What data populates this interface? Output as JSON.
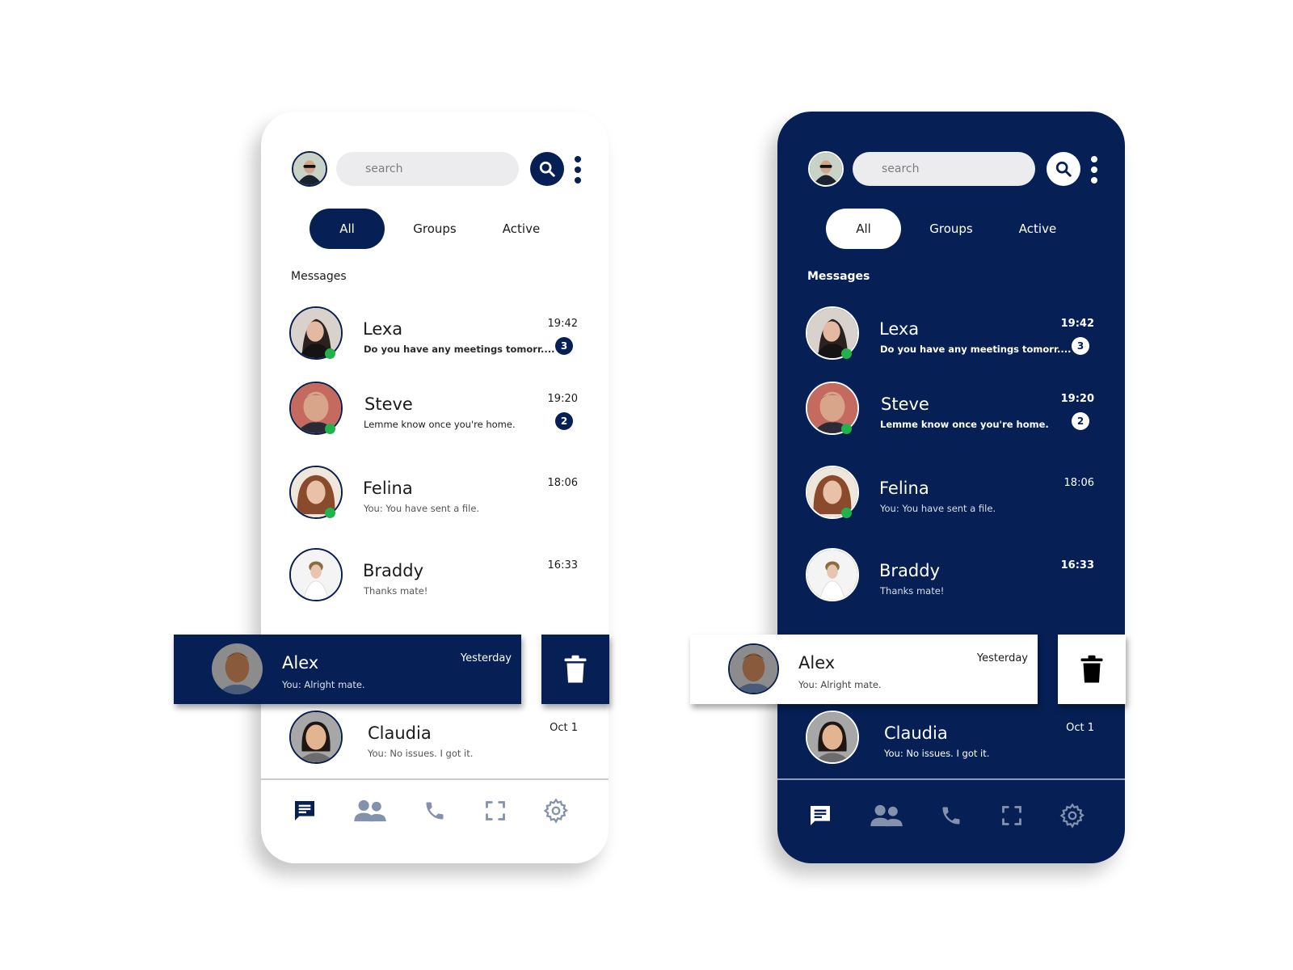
{
  "colors": {
    "brand_navy": "#062055",
    "online_green": "#22b24c",
    "search_bg": "#ececee",
    "nav_inactive": "#8391ad"
  },
  "themes": {
    "light": {
      "search": {
        "placeholder": "search"
      },
      "tabs": [
        {
          "label": "All",
          "selected": true
        },
        {
          "label": "Groups",
          "selected": false
        },
        {
          "label": "Active",
          "selected": false
        }
      ],
      "section_title": "Messages",
      "conversations": [
        {
          "name": "Lexa",
          "preview": "Do you have any meetings tomorr....",
          "time": "19:42",
          "unread": "3",
          "online": true
        },
        {
          "name": "Steve",
          "preview": "Lemme know once you're home.",
          "time": "19:20",
          "unread": "2",
          "online": true
        },
        {
          "name": "Felina",
          "preview": "You: You have sent a file.",
          "time": "18:06",
          "unread": null,
          "online": true
        },
        {
          "name": "Braddy",
          "preview": "Thanks mate!",
          "time": "16:33",
          "unread": null,
          "online": false
        },
        {
          "name": "Alex",
          "preview": "You: Alright mate.",
          "time": "Yesterday",
          "unread": null,
          "online": false,
          "swiped": true
        },
        {
          "name": "Claudia",
          "preview": "You: No issues. I got it.",
          "time": "Oct 1",
          "unread": null,
          "online": false
        }
      ],
      "nav": [
        {
          "icon": "chat-icon",
          "label": "Chats",
          "active": true
        },
        {
          "icon": "people-icon",
          "label": "Contacts",
          "active": false
        },
        {
          "icon": "phone-icon",
          "label": "Calls",
          "active": false
        },
        {
          "icon": "scan-icon",
          "label": "Scan",
          "active": false
        },
        {
          "icon": "gear-icon",
          "label": "Settings",
          "active": false
        }
      ]
    },
    "dark": {
      "search": {
        "placeholder": "search"
      },
      "tabs": [
        {
          "label": "All",
          "selected": true
        },
        {
          "label": "Groups",
          "selected": false
        },
        {
          "label": "Active",
          "selected": false
        }
      ],
      "section_title": "Messages",
      "conversations": [
        {
          "name": "Lexa",
          "preview": "Do you have any meetings tomorr....",
          "time": "19:42",
          "unread": "3",
          "online": true
        },
        {
          "name": "Steve",
          "preview": "Lemme know once you're home.",
          "time": "19:20",
          "unread": "2",
          "online": true
        },
        {
          "name": "Felina",
          "preview": "You: You have sent a file.",
          "time": "18:06",
          "unread": null,
          "online": true
        },
        {
          "name": "Braddy",
          "preview": "Thanks mate!",
          "time": "16:33",
          "unread": null,
          "online": false
        },
        {
          "name": "Alex",
          "preview": "You: Alright mate.",
          "time": "Yesterday",
          "unread": null,
          "online": false,
          "swiped": true
        },
        {
          "name": "Claudia",
          "preview": "You: No issues. I got it.",
          "time": "Oct 1",
          "unread": null,
          "online": false
        }
      ],
      "nav": [
        {
          "icon": "chat-icon",
          "label": "Chats",
          "active": true
        },
        {
          "icon": "people-icon",
          "label": "Contacts",
          "active": false
        },
        {
          "icon": "phone-icon",
          "label": "Calls",
          "active": false
        },
        {
          "icon": "scan-icon",
          "label": "Scan",
          "active": false
        },
        {
          "icon": "gear-icon",
          "label": "Settings",
          "active": false
        }
      ]
    }
  }
}
